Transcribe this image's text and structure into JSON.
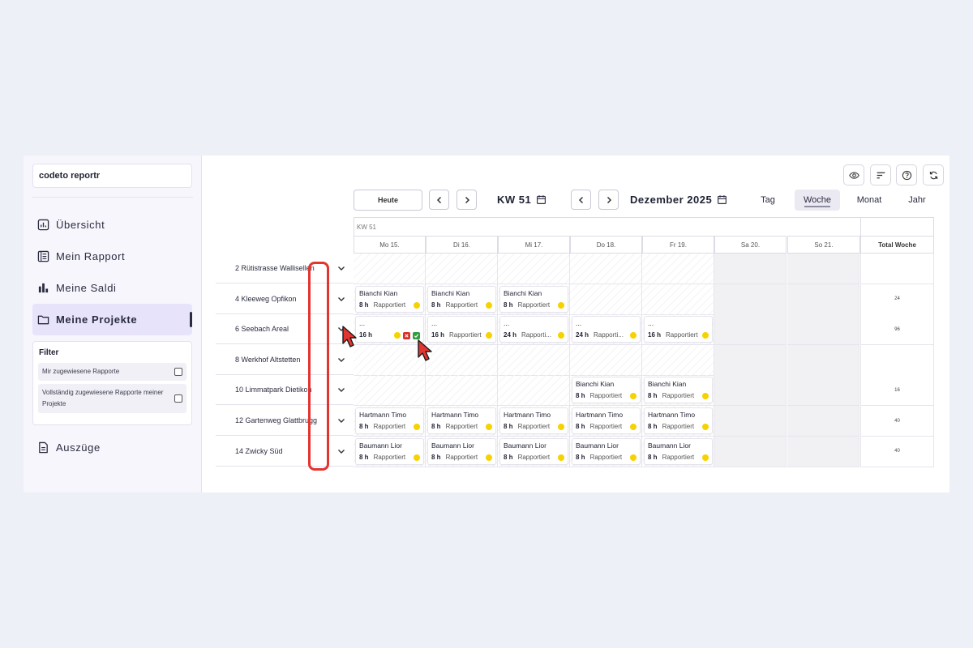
{
  "app": {
    "name": "codeto reportr"
  },
  "sidebar": {
    "nav": [
      {
        "label": "Übersicht",
        "icon": "chart-icon"
      },
      {
        "label": "Mein Rapport",
        "icon": "report-icon"
      },
      {
        "label": "Meine Saldi",
        "icon": "bar-chart-icon"
      },
      {
        "label": "Meine Projekte",
        "icon": "folder-icon",
        "active": true
      }
    ],
    "filter": {
      "title": "Filter",
      "options": [
        {
          "label": "Mir zugewiesene Rapporte",
          "checked": false
        },
        {
          "label": "Vollständig zugewiesene Rapporte meiner Projekte",
          "checked": false
        }
      ]
    },
    "extracts": {
      "label": "Auszüge",
      "icon": "document-icon"
    }
  },
  "toolbar": {
    "today_label": "Heute",
    "week_label": "KW 51",
    "month_label": "Dezember 2025",
    "views": [
      {
        "label": "Tag",
        "active": false
      },
      {
        "label": "Woche",
        "active": true
      },
      {
        "label": "Monat",
        "active": false
      },
      {
        "label": "Jahr",
        "active": false
      }
    ],
    "icons": [
      "eye-icon",
      "sort-icon",
      "help-icon",
      "refresh-icon"
    ]
  },
  "grid": {
    "week_caption": "KW 51",
    "days": [
      "Mo 15.",
      "Di 16.",
      "Mi 17.",
      "Do 18.",
      "Fr 19.",
      "Sa 20.",
      "So 21."
    ],
    "total_label": "Total Woche",
    "rows": [
      {
        "project": "2 Rütistrasse Wallisellen",
        "total": "",
        "cells": [
          null,
          null,
          null,
          null,
          null,
          null,
          null
        ]
      },
      {
        "project": "4 Kleeweg Opfikon",
        "total": "24",
        "cells": [
          {
            "name": "Bianchi Kian",
            "hours": "8 h",
            "status": "Rapportiert"
          },
          {
            "name": "Bianchi Kian",
            "hours": "8 h",
            "status": "Rapportiert"
          },
          {
            "name": "Bianchi Kian",
            "hours": "8 h",
            "status": "Rapportiert"
          },
          null,
          null,
          null,
          null
        ]
      },
      {
        "project": "6 Seebach Areal",
        "total": "96",
        "cells": [
          {
            "name": "...",
            "hours": "16 h",
            "status": "",
            "actions": true
          },
          {
            "name": "...",
            "hours": "16 h",
            "status": "Rapportiert"
          },
          {
            "name": "...",
            "hours": "24 h",
            "status": "Rapporti..."
          },
          {
            "name": "...",
            "hours": "24 h",
            "status": "Rapporti..."
          },
          {
            "name": "...",
            "hours": "16 h",
            "status": "Rapportiert"
          },
          null,
          null
        ]
      },
      {
        "project": "8 Werkhof Altstetten",
        "total": "",
        "cells": [
          null,
          null,
          null,
          null,
          null,
          null,
          null
        ]
      },
      {
        "project": "10 Limmatpark Dietikon",
        "total": "16",
        "cells": [
          null,
          null,
          null,
          {
            "name": "Bianchi Kian",
            "hours": "8 h",
            "status": "Rapportiert"
          },
          {
            "name": "Bianchi Kian",
            "hours": "8 h",
            "status": "Rapportiert"
          },
          null,
          null
        ]
      },
      {
        "project": "12 Gartenweg Glattbrugg",
        "total": "40",
        "cells": [
          {
            "name": "Hartmann Timo",
            "hours": "8 h",
            "status": "Rapportiert"
          },
          {
            "name": "Hartmann Timo",
            "hours": "8 h",
            "status": "Rapportiert"
          },
          {
            "name": "Hartmann Timo",
            "hours": "8 h",
            "status": "Rapportiert"
          },
          {
            "name": "Hartmann Timo",
            "hours": "8 h",
            "status": "Rapportiert"
          },
          {
            "name": "Hartmann Timo",
            "hours": "8 h",
            "status": "Rapportiert"
          },
          null,
          null
        ]
      },
      {
        "project": "14 Zwicky Süd",
        "total": "40",
        "cells": [
          {
            "name": "Baumann Lior",
            "hours": "8 h",
            "status": "Rapportiert"
          },
          {
            "name": "Baumann Lior",
            "hours": "8 h",
            "status": "Rapportiert"
          },
          {
            "name": "Baumann Lior",
            "hours": "8 h",
            "status": "Rapportiert"
          },
          {
            "name": "Baumann Lior",
            "hours": "8 h",
            "status": "Rapportiert"
          },
          {
            "name": "Baumann Lior",
            "hours": "8 h",
            "status": "Rapportiert"
          },
          null,
          null
        ]
      }
    ]
  },
  "colors": {
    "accent": "#e7e3fb",
    "status_dot": "#f7d200",
    "reject": "#d9302c",
    "approve": "#2e9e3f",
    "highlight": "#e4342f"
  }
}
